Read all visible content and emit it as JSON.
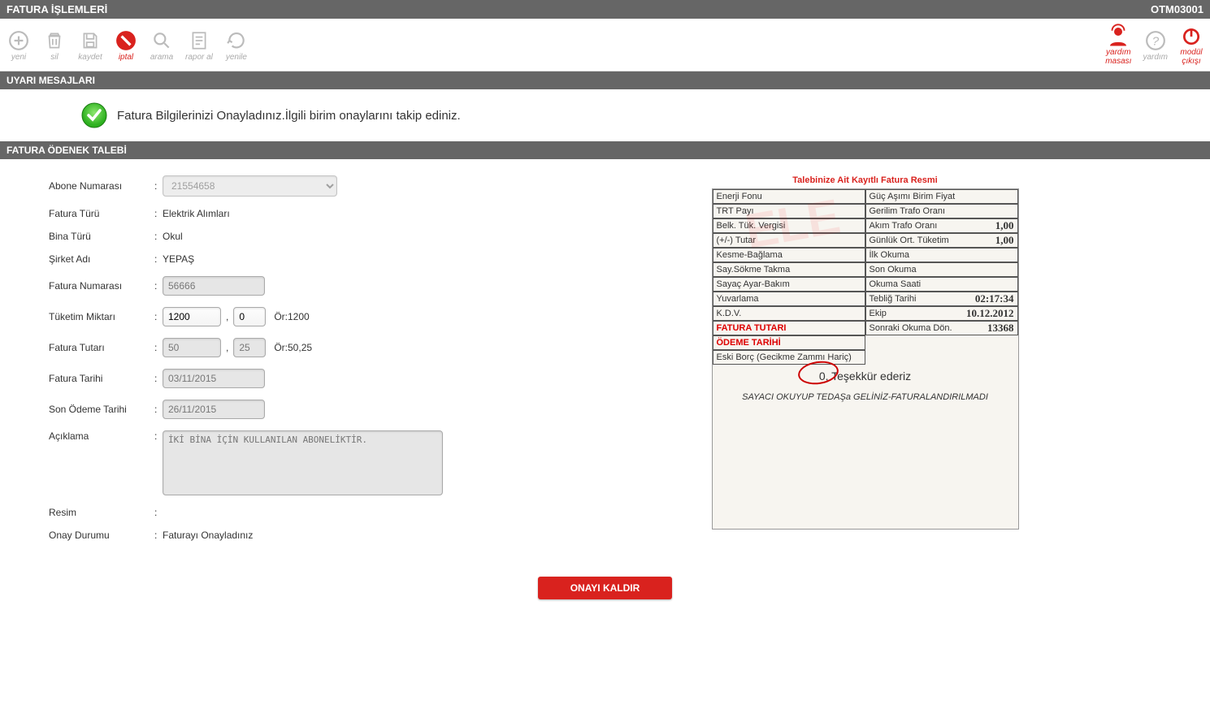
{
  "header": {
    "title": "FATURA İŞLEMLERİ",
    "code": "OTM03001"
  },
  "toolbar": {
    "yeni": "yeni",
    "sil": "sil",
    "kaydet": "kaydet",
    "iptal": "iptal",
    "arama": "arama",
    "rapor": "rapor al",
    "yenile": "yenile",
    "yardim_masasi": "yardım\nmasası",
    "yardim": "yardım",
    "modul_cikis": "modül\nçıkışı"
  },
  "alert": {
    "title": "UYARI MESAJLARI",
    "text": "Fatura Bilgilerinizi Onayladınız.İlgili birim onaylarını takip ediniz."
  },
  "section": {
    "title": "FATURA ÖDENEK TALEBİ"
  },
  "form": {
    "abone_no_label": "Abone Numarası",
    "abone_no_value": "21554658",
    "fatura_turu_label": "Fatura Türü",
    "fatura_turu_value": "Elektrik Alımları",
    "bina_turu_label": "Bina Türü",
    "bina_turu_value": "Okul",
    "sirket_label": "Şirket Adı",
    "sirket_value": "YEPAŞ",
    "fatura_no_label": "Fatura Numarası",
    "fatura_no_value": "56666",
    "tuketim_label": "Tüketim Miktarı",
    "tuketim_int": "1200",
    "tuketim_dec": "0",
    "tuketim_hint": "Ör:1200",
    "tutar_label": "Fatura Tutarı",
    "tutar_int": "50",
    "tutar_dec": "25",
    "tutar_hint": "Ör:50,25",
    "fatura_tarihi_label": "Fatura Tarihi",
    "fatura_tarihi_value": "03/11/2015",
    "son_odeme_label": "Son Ödeme Tarihi",
    "son_odeme_value": "26/11/2015",
    "aciklama_label": "Açıklama",
    "aciklama_value": "İKİ BİNA İÇİN KULLANILAN ABONELİKTİR.",
    "resim_label": "Resim",
    "resim_value": "",
    "onay_label": "Onay Durumu",
    "onay_value": "Faturayı Onayladınız"
  },
  "image": {
    "caption": "Talebinize Ait Kayıtlı Fatura Resmi",
    "left_rows": [
      "Enerji Fonu",
      "TRT Payı",
      "Belk. Tük. Vergisi",
      "(+/-) Tutar",
      "Kesme-Bağlama",
      "Say.Sökme Takma",
      "Sayaç Ayar-Bakım",
      "Yuvarlama",
      "K.D.V."
    ],
    "left_red": [
      "FATURA TUTARI",
      "ÖDEME TARİHİ"
    ],
    "eski_borc": "Eski Borç (Gecikme Zammı Hariç)",
    "right_rows": [
      {
        "label": "Güç Aşımı Birim Fiyat",
        "val": ""
      },
      {
        "label": "Gerilim Trafo Oranı",
        "val": ""
      },
      {
        "label": "Akım Trafo Oranı",
        "val": "1,00"
      },
      {
        "label": "Günlük Ort. Tüketim",
        "val": "1,00"
      },
      {
        "label": "İlk Okuma",
        "val": ""
      },
      {
        "label": "Son Okuma",
        "val": ""
      },
      {
        "label": "Okuma Saati",
        "val": ""
      },
      {
        "label": "Tebliğ Tarihi",
        "val": "02:17:34"
      },
      {
        "label": "Ekip",
        "val": "10.12.2012"
      },
      {
        "label": "Sonraki Okuma Dön.",
        "val": "13368"
      }
    ],
    "thanks": "0, Teşekkür ederiz",
    "footer": "SAYACI OKUYUP TEDAŞa GELİNİZ-FATURALANDIRILMADI"
  },
  "button": {
    "onay_kaldir": "ONAYI KALDIR"
  }
}
